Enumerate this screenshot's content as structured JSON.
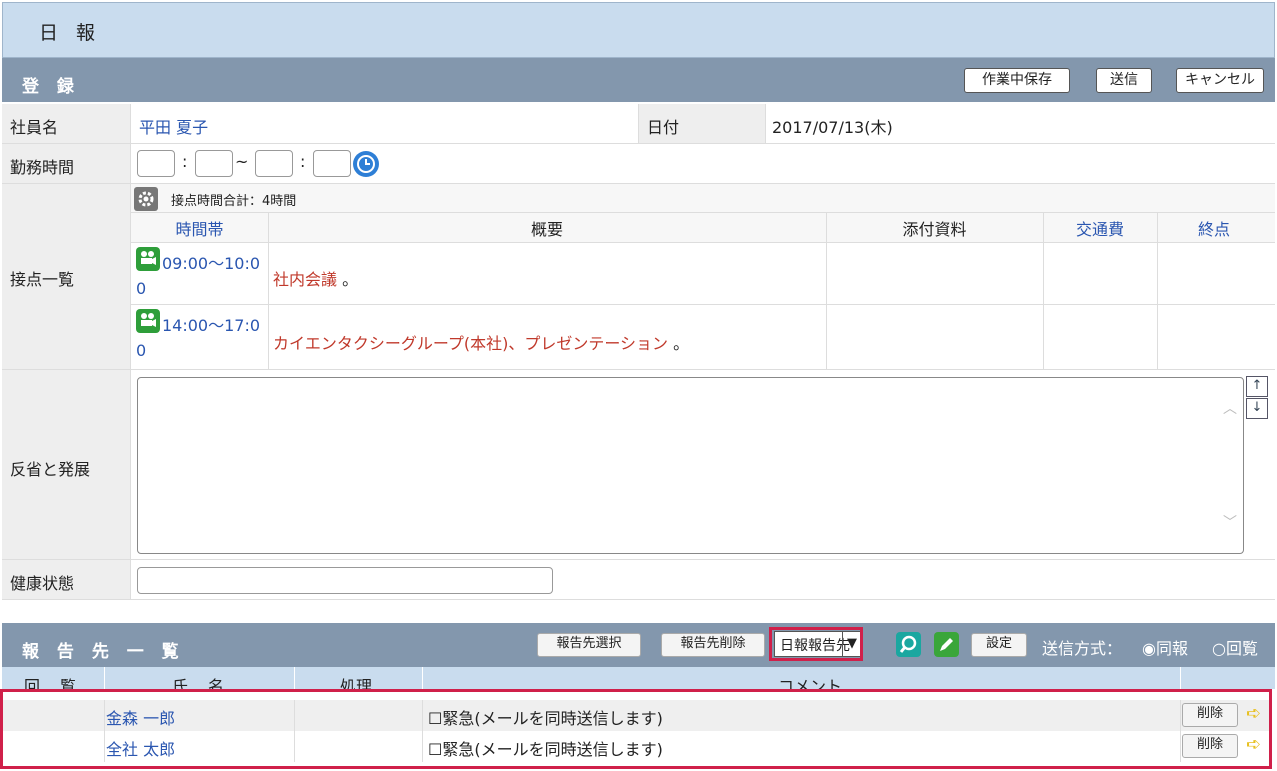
{
  "page": {
    "title": "日 報"
  },
  "register": {
    "header": "登 録",
    "buttons": {
      "save_draft": "作業中保存",
      "send": "送信",
      "cancel": "キャンセル"
    },
    "employee_label": "社員名",
    "employee_name": "平田 夏子",
    "date_label": "日付",
    "date_value": "2017/07/13(木)",
    "work_time_label": "勤務時間",
    "work_time_sep": ":",
    "work_time_tilde": "~",
    "contacts_label": "接点一覧",
    "contacts_total": "接点時間合計：4時間",
    "contacts_headers": {
      "time": "時間帯",
      "summary": "概要",
      "attachment": "添付資料",
      "transport": "交通費",
      "end": "終点"
    },
    "contacts": [
      {
        "time_line1": "09:00～10:0",
        "time_line2": "0",
        "summary": "社内会議",
        "suffix": " 。"
      },
      {
        "time_line1": "14:00～17:0",
        "time_line2": "0",
        "summary": "カイエンタクシーグループ(本社)、プレゼンテーション",
        "suffix": " 。"
      }
    ],
    "reflection_label": "反省と発展",
    "health_label": "健康状態"
  },
  "report_to": {
    "header": "報 告 先 一 覧",
    "buttons": {
      "select": "報告先選択",
      "delete": "報告先削除",
      "settings": "設定"
    },
    "dropdown_value": "日報報告先",
    "send_method_label": "送信方式：",
    "send_method_options": [
      "同報",
      "回覧"
    ],
    "send_method_selected": "同報",
    "columns": [
      "回　覧",
      "氏　名",
      "処理",
      "コメント"
    ],
    "rows": [
      {
        "name": "金森 一郎",
        "urgent": "緊急(メールを同時送信します)",
        "delete": "削除"
      },
      {
        "name": "全社 太郎",
        "urgent": "緊急(メールを同時送信します)",
        "delete": "削除"
      }
    ]
  }
}
